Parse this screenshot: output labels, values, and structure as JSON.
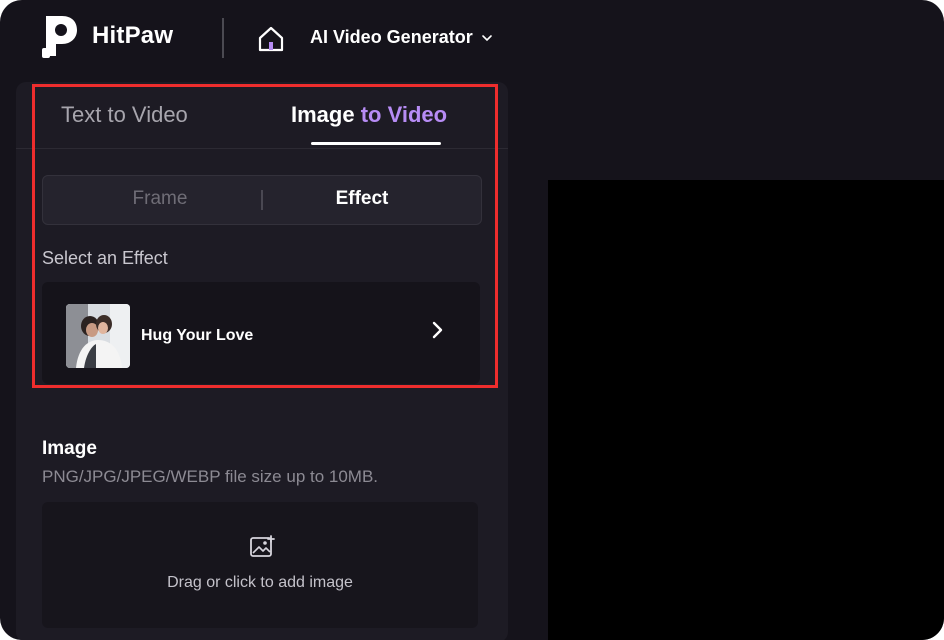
{
  "header": {
    "brand": "HitPaw",
    "product": "AI Video Generator"
  },
  "tabs": {
    "text_to_video": "Text to Video",
    "image_to_video_part1": "Image",
    "image_to_video_part2": "to Video"
  },
  "segment": {
    "frame": "Frame",
    "effect": "Effect",
    "selected": "Effect"
  },
  "effect_section": {
    "label": "Select an Effect",
    "selected_effect": "Hug Your Love"
  },
  "image_section": {
    "label": "Image",
    "hint": "PNG/JPG/JPEG/WEBP file size up to 10MB.",
    "dropzone_text": "Drag or click to add image"
  },
  "colors": {
    "background": "#15131b",
    "panel": "#1d1b24",
    "accent": "#b78cf5",
    "highlight_box": "#ee2d2d"
  },
  "icons": [
    "hitpaw-logo-icon",
    "home-icon",
    "chevron-down-icon",
    "chevron-right-icon",
    "image-add-icon"
  ]
}
